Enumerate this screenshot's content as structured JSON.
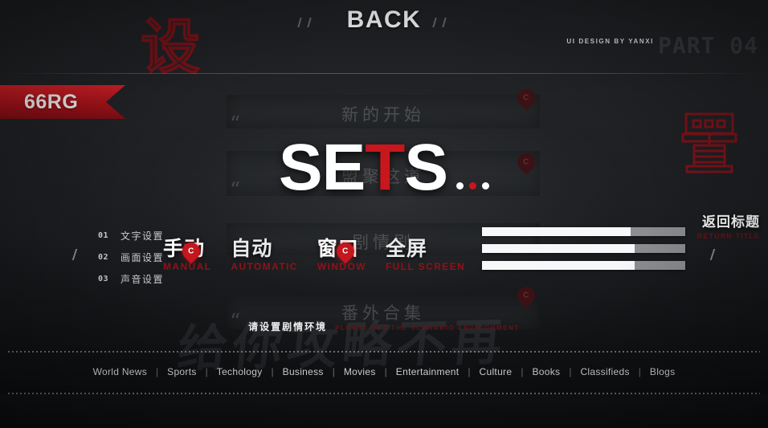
{
  "header": {
    "back_title": "BACK",
    "decor_glyph": "设",
    "credit": "UI DESIGN BY YANXI",
    "part_label": "PART 04"
  },
  "ribbon": {
    "label": "66RG"
  },
  "bands": {
    "band1_cn": "新的开始",
    "band2_cn": "盟聚这道",
    "band3_cn": "剧情剧",
    "band4_cn": "番外合集",
    "quote": "“"
  },
  "headline": {
    "char1": "S",
    "char2": "E",
    "char3": "T",
    "char4": "S",
    "ellipsis_dots": 3
  },
  "menu": {
    "items": [
      {
        "num": "01",
        "label": "文字设置"
      },
      {
        "num": "02",
        "label": "画面设置"
      },
      {
        "num": "03",
        "label": "声音设置"
      }
    ]
  },
  "options": [
    {
      "cn": "手动",
      "en": "MANUAL",
      "marker": "C",
      "marker_active": true
    },
    {
      "cn": "自动",
      "en": "AUTOMATIC",
      "marker": "",
      "marker_active": false
    },
    {
      "cn": "窗口",
      "en": "WINDOW",
      "marker": "C",
      "marker_active": true
    },
    {
      "cn": "全屏",
      "en": "FULL SCREEN",
      "marker": "",
      "marker_active": false
    }
  ],
  "sliders": [
    {
      "name": "text-slider",
      "value": 73
    },
    {
      "name": "image-slider",
      "value": 75
    },
    {
      "name": "sound-slider",
      "value": 75
    }
  ],
  "return_block": {
    "cn": "返回标题",
    "en": "RETURN TITLE"
  },
  "scenario": {
    "cn": "请设置剧情环境",
    "en": "PLEASE SET THE SCENARIO ENVIRONMENT"
  },
  "watermark": {
    "text": "给你攻略不再"
  },
  "bottom_nav": {
    "items": [
      "World News",
      "Sports",
      "Techology",
      "Business",
      "Movies",
      "Entertainment",
      "Culture",
      "Books",
      "Classifieds",
      "Blogs"
    ],
    "separator": "|"
  },
  "markers": {
    "pin_letter": "C"
  },
  "colors": {
    "accent_red": "#c8161d",
    "ribbon_red": "#a5121a",
    "dark_red": "#6b1015",
    "bg": "#1a1c1f",
    "text": "#dcdfe3"
  }
}
